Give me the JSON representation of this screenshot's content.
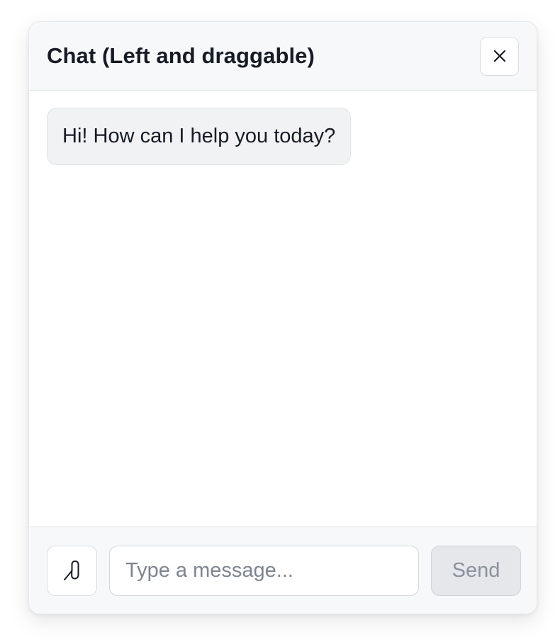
{
  "header": {
    "title": "Chat (Left and draggable)",
    "close_icon": "close-icon"
  },
  "messages": [
    {
      "sender": "assistant",
      "text": "Hi! How can I help you today?"
    }
  ],
  "composer": {
    "attach_icon": "paperclip-icon",
    "input_value": "",
    "input_placeholder": "Type a message...",
    "send_label": "Send",
    "send_disabled": true
  },
  "colors": {
    "header_bg": "#f7f8fa",
    "bubble_bg": "#f1f2f4",
    "text": "#161b26",
    "send_disabled_bg": "#e5e7eb",
    "send_disabled_text": "#8b929c"
  }
}
